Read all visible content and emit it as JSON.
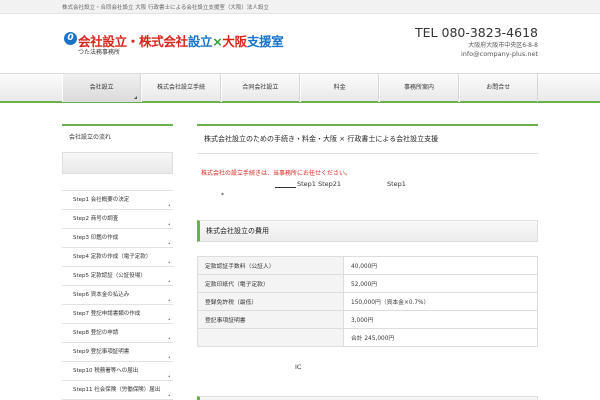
{
  "topbar": {
    "text": "株式会社設立・合同会社設立 大阪 行政書士による会社設立支援室（大阪）法人設立"
  },
  "logo": {
    "mark": "0",
    "title_part1": "会社設立・",
    "title_part2": "株式会社",
    "title_part3": "設立",
    "title_part4": "×",
    "title_part5": "大阪",
    "title_part6": "支援室",
    "subtitle": "つた法務事務所"
  },
  "contact": {
    "tel": "TEL 080-3823-4618",
    "address": "大阪府大阪市中央区6-8-8",
    "email": "info@company-plus.net"
  },
  "nav": {
    "items": [
      {
        "label": "会社設立"
      },
      {
        "label": "株式会社設立手続"
      },
      {
        "label": "合同会社設立"
      },
      {
        "label": "料金"
      },
      {
        "label": "事務所案内"
      },
      {
        "label": "お問合せ"
      }
    ]
  },
  "sidebar": {
    "title": "会社設立の流れ",
    "items": [
      {
        "label": "Step1 会社概要の決定"
      },
      {
        "label": "Step2 商号の調査"
      },
      {
        "label": "Step3 印鑑の作成"
      },
      {
        "label": "Step4 定款の作成（電子定款）"
      },
      {
        "label": "Step5 定款認証（公証役場）"
      },
      {
        "label": "Step6 資本金の払込み"
      },
      {
        "label": "Step7 登記申請書類の作成"
      },
      {
        "label": "Step8 登記の申請"
      },
      {
        "label": "Step9 登記事項証明書"
      },
      {
        "label": "Step10 税務署等への届出"
      },
      {
        "label": "Step11 社会保険（労働保険）届出"
      }
    ]
  },
  "main": {
    "title": "株式会社設立のための手続き・料金・大阪 × 行政書士による会社設立支援",
    "red_note": "株式会社の設立手続きは、当事務所にお任せください。",
    "step_a": "Step1  Step21",
    "step_b": "Step1",
    "star": "*",
    "section_title": "株式会社設立の費用",
    "fees": [
      {
        "label": "定款認証手数料（公証人）",
        "value": "40,000円"
      },
      {
        "label": "定款印紙代（電子定款）",
        "value": "52,000円"
      },
      {
        "label": "登録免許税（最低）",
        "value": "150,000円（資本金×0.7%）"
      },
      {
        "label": "登記事項証明書",
        "value": "3,000円"
      },
      {
        "label": "",
        "value": "合計 245,000円"
      }
    ],
    "ic_text": "IC"
  }
}
